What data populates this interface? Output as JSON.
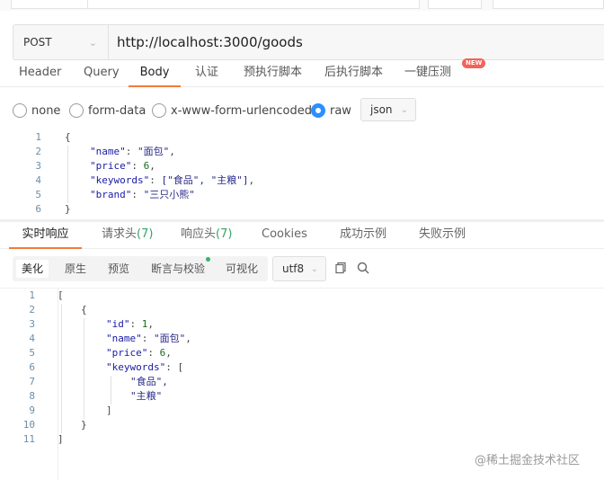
{
  "request": {
    "method": "POST",
    "url": "http://localhost:3000/goods",
    "tabs": [
      "Header",
      "Query",
      "Body",
      "认证",
      "预执行脚本",
      "后执行脚本",
      "一键压测"
    ],
    "active_tab": "Body",
    "new_badge": "NEW",
    "body_modes": [
      "none",
      "form-data",
      "x-www-form-urlencoded",
      "raw"
    ],
    "selected_mode": "raw",
    "body_format": "json",
    "body_lines": [
      {
        "num": "1",
        "text": "{"
      },
      {
        "num": "2",
        "key": "\"name\"",
        "value": "\"面包\"",
        "end": ","
      },
      {
        "num": "3",
        "key": "\"price\"",
        "value": "6",
        "end": ","
      },
      {
        "num": "4",
        "key": "\"keywords\"",
        "value": "[\"食品\", \"主粮\"]",
        "end": ","
      },
      {
        "num": "5",
        "key": "\"brand\"",
        "value": "\"三只小熊\"",
        "end": ""
      },
      {
        "num": "6",
        "text": "}"
      }
    ]
  },
  "response": {
    "tabs": [
      {
        "label": "实时响应",
        "count": ""
      },
      {
        "label": "请求头",
        "count": "(7)"
      },
      {
        "label": "响应头",
        "count": "(7)"
      },
      {
        "label": "Cookies",
        "count": ""
      },
      {
        "label": "成功示例",
        "count": ""
      },
      {
        "label": "失败示例",
        "count": ""
      }
    ],
    "active_tab": "实时响应",
    "view_modes": [
      "美化",
      "原生",
      "预览",
      "断言与校验",
      "可视化"
    ],
    "active_view": "美化",
    "encoding": "utf8",
    "icons": [
      "copy-icon",
      "search-icon"
    ],
    "body_lines": [
      {
        "num": "1",
        "text": "["
      },
      {
        "num": "2",
        "text": "{"
      },
      {
        "num": "3",
        "key": "\"id\"",
        "value": "1",
        "end": ","
      },
      {
        "num": "4",
        "key": "\"name\"",
        "value": "\"面包\"",
        "end": ","
      },
      {
        "num": "5",
        "key": "\"price\"",
        "value": "6",
        "end": ","
      },
      {
        "num": "6",
        "key": "\"keywords\"",
        "value": "[",
        "end": ""
      },
      {
        "num": "7",
        "text": "\"食品\","
      },
      {
        "num": "8",
        "text": "\"主粮\""
      },
      {
        "num": "9",
        "text": "]"
      },
      {
        "num": "10",
        "text": "}"
      },
      {
        "num": "11",
        "text": "]"
      }
    ]
  },
  "watermark": "@稀土掘金技术社区",
  "colors": {
    "accent": "#f37b3b",
    "radio_checked": "#2b8fff",
    "badge": "#f2625a",
    "count_green": "#3aa16a"
  }
}
